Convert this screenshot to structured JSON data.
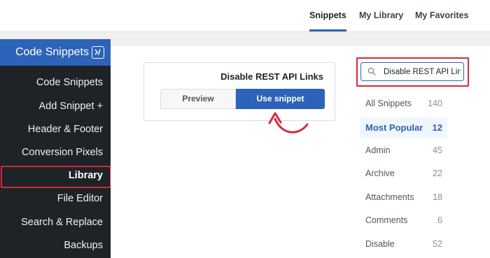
{
  "top_tabs": [
    {
      "label": "Snippets",
      "active": true
    },
    {
      "label": "My Library",
      "active": false
    },
    {
      "label": "My Favorites",
      "active": false
    }
  ],
  "sidebar": {
    "header_title": "Code Snippets",
    "header_icon": "code-snippets-logo-icon",
    "items": [
      {
        "label": "Code Snippets"
      },
      {
        "label": "Add Snippet +"
      },
      {
        "label": "Header & Footer"
      },
      {
        "label": "Conversion Pixels"
      },
      {
        "label": "Library",
        "active": true
      },
      {
        "label": "File Editor"
      },
      {
        "label": "Search & Replace"
      },
      {
        "label": "Backups"
      }
    ]
  },
  "snippet_card": {
    "title": "Disable REST API Links",
    "preview_label": "Preview",
    "use_label": "Use snippet"
  },
  "search": {
    "value": "Disable REST API Links",
    "icon": "search-icon"
  },
  "categories": [
    {
      "name": "All Snippets",
      "count": "140"
    },
    {
      "name": "Most Popular",
      "count": "12",
      "active": true
    },
    {
      "name": "Admin",
      "count": "45"
    },
    {
      "name": "Archive",
      "count": "22"
    },
    {
      "name": "Attachments",
      "count": "18"
    },
    {
      "name": "Comments",
      "count": "6"
    },
    {
      "name": "Disable",
      "count": "52"
    }
  ],
  "colors": {
    "accent": "#2d63b8",
    "highlight": "#d6293e",
    "sidebar_bg": "#1d2327"
  }
}
